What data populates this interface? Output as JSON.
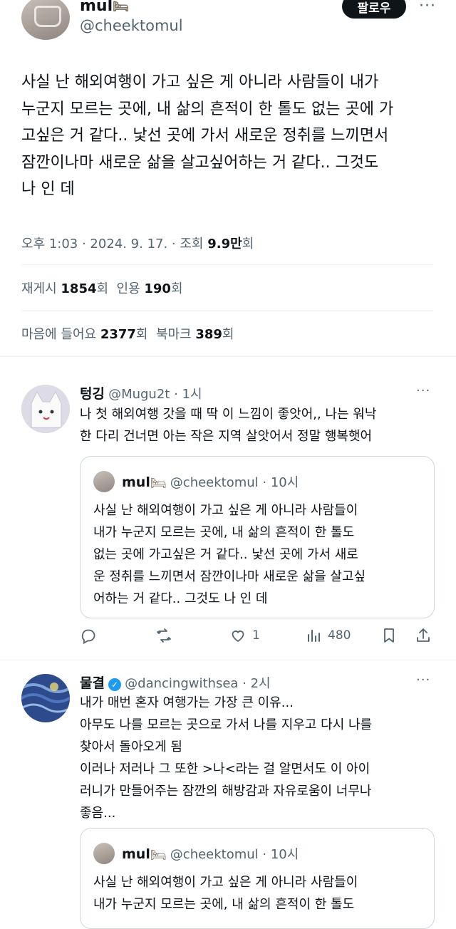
{
  "main_tweet": {
    "name": "mul",
    "handle": "@cheektomul",
    "follow_label": "팔로우",
    "more": "···",
    "lines": [
      "사실 난 해외여행이 가고 싶은 게 아니라 사람들이 내가",
      "누군지 모르는 곳에, 내 삶의 흔적이 한 톨도 없는 곳에 가",
      "고싶은 거 같다.. 낯선 곳에 가서 새로운 정취를 느끼면서",
      "잠깐이나마 새로운 삶을 살고싶어하는 거 같다.. 그것도",
      "나 인 데"
    ],
    "time": "오후 1:03 · 2024. 9. 17. · 조회 ",
    "views": "9.9만",
    "views_unit": "회",
    "reposts_label": "재게시 ",
    "reposts": "1854",
    "reposts_unit": "회",
    "quotes_label": "인용 ",
    "quotes": "190",
    "quotes_unit": "회",
    "likes_label": "마음에 들어요 ",
    "likes": "2377",
    "likes_unit": "회",
    "bookmarks_label": "북마크 ",
    "bookmarks": "389",
    "bookmarks_unit": "회"
  },
  "reply1": {
    "name": "텅깅",
    "handle": "@Mugu2t · 1시",
    "more": "···",
    "lines": [
      "나 첫 해외여행 갓을 때 딱 이 느낌이 좋앗어,, 나는 워낙",
      "한 다리 건너면 아는 작은 지역 살앗어서 정말 행복햇어"
    ],
    "quote": {
      "name": "mul",
      "handle": "@cheektomul · 10시",
      "lines": [
        "사실 난 해외여행이 가고 싶은 게 아니라 사람들이",
        "내가 누군지 모르는 곳에, 내 삶의 흔적이 한 톨도",
        "없는 곳에 가고싶은 거 같다.. 낯선 곳에 가서 새로",
        "운 정취를 느끼면서 잠깐이나마 새로운 삶을 살고싶",
        "어하는 거 같다.. 그것도 나 인 데"
      ]
    },
    "actions": {
      "reply": "",
      "repost": "",
      "like": "1",
      "views": "480"
    }
  },
  "reply2": {
    "name": "물결",
    "handle": "@dancingwithsea · 2시",
    "more": "···",
    "lines": [
      "내가 매번 혼자 여행가는 가장 큰 이유...",
      "아무도 나를 모르는 곳으로 가서 나를 지우고 다시 나를",
      "찾아서 돌아오게 됨",
      "이러나 저러나 그 또한 >나<라는 걸 알면서도 이 아이",
      "러니가 만들어주는 잠깐의 해방감과 자유로움이 너무나",
      "좋음..."
    ],
    "quote": {
      "name": "mul",
      "handle": "@cheektomul · 10시",
      "lines": [
        "사실 난 해외여행이 가고 싶은 게 아니라 사람들이",
        "내가 누군지 모르는 곳에, 내 삶의 흔적이 한 톨도"
      ]
    }
  },
  "colors": {
    "accent": "#1d9bf0",
    "text": "#0f1419",
    "muted": "#536471",
    "border": "#cfd9de"
  },
  "icons": [
    "more-icon",
    "bed-emoji-icon",
    "reply-icon",
    "repost-icon",
    "like-icon",
    "views-icon",
    "bookmark-icon",
    "share-icon",
    "verified-icon"
  ]
}
